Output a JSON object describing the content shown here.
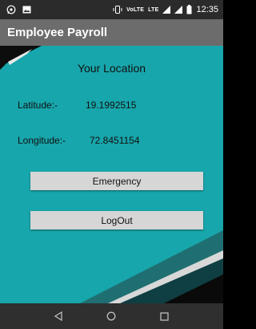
{
  "status_bar": {
    "left_icons": [
      "whatsapp-icon",
      "image-icon"
    ],
    "right_icons": [
      "vibrate-icon",
      "volte-icon",
      "lte-icon",
      "signal-icon",
      "signal-icon",
      "battery-icon"
    ],
    "volte_text": "VoLTE",
    "lte_text": "LTE",
    "time": "12:35"
  },
  "app_bar": {
    "title": "Employee Payroll"
  },
  "main": {
    "title": "Your Location",
    "latitude_label": "Latitude:-",
    "latitude_value": "19.1992515",
    "longitude_label": "Longitude:-",
    "longitude_value": "72.8451154",
    "emergency_button": "Emergency",
    "logout_button": "LogOut"
  },
  "nav_bar": {
    "icons": [
      "back-icon",
      "home-icon",
      "recents-icon"
    ]
  },
  "colors": {
    "background_teal": "#17a6ab",
    "app_bar": "#6c6c6c",
    "status_bar": "#2b2b2b",
    "nav_bar": "#2f2f2f",
    "button": "#d6d6d6"
  }
}
